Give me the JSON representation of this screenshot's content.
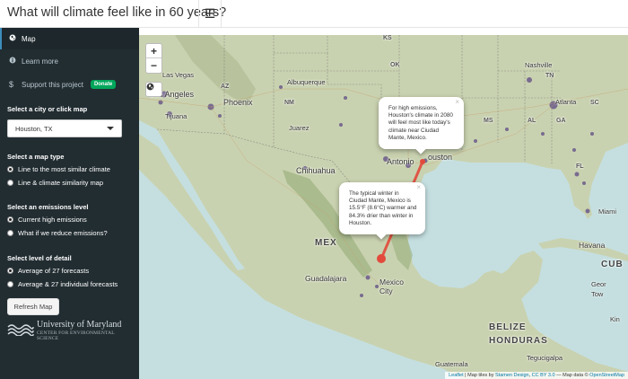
{
  "header": {
    "title": "What will climate feel like in 60 years?",
    "menu_icon": "hamburger-icon"
  },
  "sidebar": {
    "nav": [
      {
        "label": "Map",
        "icon": "globe-icon",
        "active": true
      },
      {
        "label": "Learn more",
        "icon": "info-icon",
        "active": false
      },
      {
        "label": "Support this project",
        "icon": "dollar-icon",
        "active": false,
        "badge": "Donate"
      }
    ],
    "city": {
      "label": "Select a city or click map",
      "value": "Houston, TX"
    },
    "map_type": {
      "label": "Select a map type",
      "options": [
        "Line to the most similar climate",
        "Line & climate similarity map"
      ],
      "selected": 0
    },
    "emissions": {
      "label": "Select an emissions level",
      "options": [
        "Current high emissions",
        "What if we reduce emissions?"
      ],
      "selected": 0
    },
    "detail": {
      "label": "Select level of detail",
      "options": [
        "Average of 27 forecasts",
        "Average & 27 individual forecasts"
      ],
      "selected": 0
    },
    "refresh_label": "Refresh Map",
    "logo": {
      "title": "University of Maryland",
      "subtitle": "CENTER FOR ENVIRONMENTAL SCIENCE"
    }
  },
  "map": {
    "zoom_in": "+",
    "zoom_out": "−",
    "popup_houston": "For high emissions, Houston's climate in 2080 will feel most like today's climate near Ciudad Mante, Mexico.",
    "popup_mante": "The typical winter in Ciudad Mante, Mexico is 15.5°F (8.6°C) warmer and 84.3% drier than winter in Houston.",
    "attribution": {
      "leaflet": "Leaflet",
      "text1": " | Map tiles by ",
      "stamen": "Stamen Design",
      "text2": ", ",
      "ccby": "CC BY 3.0",
      "text3": " — Map data © ",
      "osm": "OpenStreetMap"
    },
    "labels": {
      "las_vegas": "Las Vegas",
      "los_angeles": "Los Angeles",
      "tijuana": "Tijuana",
      "phoenix": "Phoenix",
      "az": "AZ",
      "albuquerque": "Albuquerque",
      "nm": "NM",
      "juarez": "Juarez",
      "chihuahua": "Chihuahua",
      "antonio": "Antonio",
      "houston": "ouston",
      "mexico": "MEX",
      "guadalajara": "Guadalajara",
      "mexico_city": "Mexico\nCity",
      "belize": "BELIZE",
      "honduras": "HONDURAS",
      "guatemala": "Guatemala",
      "tegucigalpa": "Tegucigalpa",
      "havana": "Havana",
      "cuba": "CUB",
      "george_town": "Geor\nTow",
      "kingston": "Kin",
      "miami": "Miami",
      "atlanta": "Atlanta",
      "nashville": "Nashville",
      "ms": "MS",
      "al": "AL",
      "ga": "GA",
      "sc": "SC",
      "fl": "FL",
      "tn": "TN",
      "ks": "KS",
      "ok": "OK"
    }
  }
}
